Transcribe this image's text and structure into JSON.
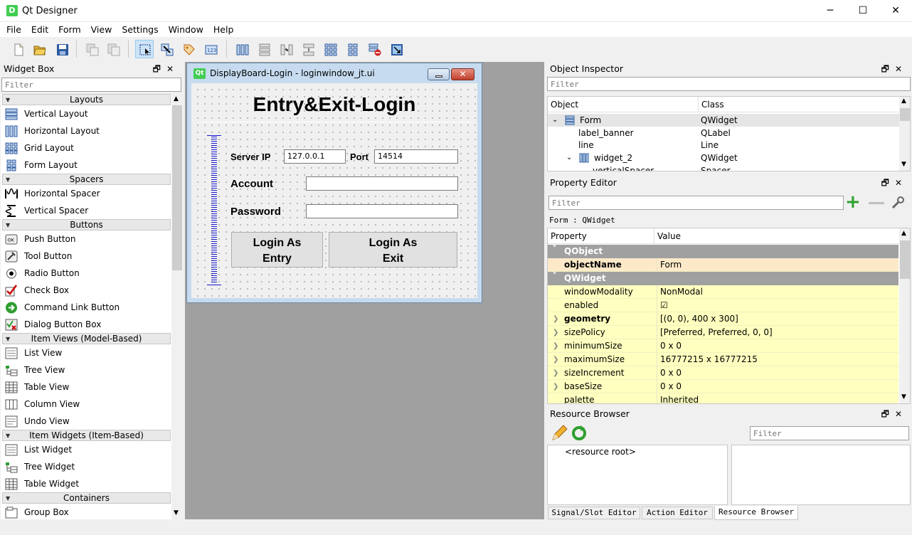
{
  "window": {
    "app_icon": "D",
    "title": "Qt Designer",
    "minimize": "─",
    "maximize": "☐",
    "close": "✕"
  },
  "menu": [
    "File",
    "Edit",
    "Form",
    "View",
    "Settings",
    "Window",
    "Help"
  ],
  "toolbar_icons": [
    "new-form-icon",
    "open-form-icon",
    "save-form-icon",
    "copy-icon",
    "paste-icon",
    "edit-widgets-icon",
    "edit-signals-slots-icon",
    "edit-buddies-icon",
    "edit-tab-order-icon",
    "layout-horizontal-icon",
    "layout-vertical-icon",
    "layout-horizontal-splitter-icon",
    "layout-vertical-splitter-icon",
    "layout-grid-icon",
    "layout-form-icon",
    "break-layout-icon",
    "adjust-size-icon"
  ],
  "widget_box": {
    "title": "Widget Box",
    "dock_float": "🗗",
    "dock_close": "✕",
    "filter_placeholder": "Filter",
    "categories": [
      {
        "name": "Layouts",
        "items": [
          "Vertical Layout",
          "Horizontal Layout",
          "Grid Layout",
          "Form Layout"
        ]
      },
      {
        "name": "Spacers",
        "items": [
          "Horizontal Spacer",
          "Vertical Spacer"
        ]
      },
      {
        "name": "Buttons",
        "items": [
          "Push Button",
          "Tool Button",
          "Radio Button",
          "Check Box",
          "Command Link Button",
          "Dialog Button Box"
        ]
      },
      {
        "name": "Item Views (Model-Based)",
        "items": [
          "List View",
          "Tree View",
          "Table View",
          "Column View",
          "Undo View"
        ]
      },
      {
        "name": "Item Widgets (Item-Based)",
        "items": [
          "List Widget",
          "Tree Widget",
          "Table Widget"
        ]
      },
      {
        "name": "Containers",
        "items": [
          "Group Box"
        ]
      }
    ]
  },
  "form_window": {
    "icon": "Qt",
    "title": "DisplayBoard-Login - loginwindow_jt.ui",
    "banner": "Entry&Exit-Login",
    "server_ip_label": "Server IP",
    "server_ip_value": "127.0.0.1",
    "port_label": "Port",
    "port_value": "14514",
    "account_label": "Account",
    "account_value": "",
    "password_label": "Password",
    "password_value": "",
    "login_entry_line1": "Login As",
    "login_entry_line2": "Entry",
    "login_exit_line1": "Login As",
    "login_exit_line2": "Exit"
  },
  "object_inspector": {
    "title": "Object Inspector",
    "filter_placeholder": "Filter",
    "col_object": "Object",
    "col_class": "Class",
    "rows": [
      {
        "object": "Form",
        "class": "QWidget",
        "selected": true
      },
      {
        "object": "label_banner",
        "class": "QLabel"
      },
      {
        "object": "line",
        "class": "Line"
      },
      {
        "object": "widget_2",
        "class": "QWidget"
      },
      {
        "object": "verticalSpacer",
        "class": "Spacer"
      }
    ]
  },
  "property_editor": {
    "title": "Property Editor",
    "filter_placeholder": "Filter",
    "context": "Form : QWidget",
    "col_property": "Property",
    "col_value": "Value",
    "group_qobject": "QObject",
    "group_qwidget": "QWidget",
    "object_name": {
      "name": "objectName",
      "value": "Form"
    },
    "props": [
      {
        "name": "windowModality",
        "value": "NonModal",
        "bold": false,
        "expand": false
      },
      {
        "name": "enabled",
        "value": "☑",
        "bold": false,
        "expand": false
      },
      {
        "name": "geometry",
        "value": "[(0, 0), 400 x 300]",
        "bold": true,
        "expand": true
      },
      {
        "name": "sizePolicy",
        "value": "[Preferred, Preferred, 0, 0]",
        "bold": false,
        "expand": true
      },
      {
        "name": "minimumSize",
        "value": "0 x 0",
        "bold": false,
        "expand": true
      },
      {
        "name": "maximumSize",
        "value": "16777215 x 16777215",
        "bold": false,
        "expand": true
      },
      {
        "name": "sizeIncrement",
        "value": "0 x 0",
        "bold": false,
        "expand": true
      },
      {
        "name": "baseSize",
        "value": "0 x 0",
        "bold": false,
        "expand": true
      },
      {
        "name": "palette",
        "value": "Inherited",
        "bold": false,
        "expand": false
      }
    ]
  },
  "resource_browser": {
    "title": "Resource Browser",
    "filter_placeholder": "Filter",
    "root": "<resource root>",
    "tabs": [
      "Signal/Slot Editor",
      "Action Editor",
      "Resource Browser"
    ]
  },
  "colors": {
    "accent_selected": "#cde4f7",
    "property_row": "#ffffbf",
    "group_header": "#a0a0a0",
    "canvas": "#a0a0a0",
    "qt_green": "#41cd52"
  }
}
